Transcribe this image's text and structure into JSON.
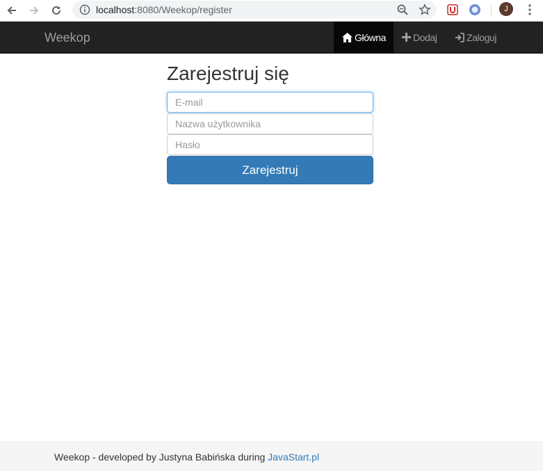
{
  "browser": {
    "url_host": "localhost",
    "url_rest": ":8080/Weekop/register",
    "avatar_letter": "J"
  },
  "navbar": {
    "brand": "Weekop",
    "items": [
      {
        "label": "Główna",
        "icon": "home-icon",
        "active": true
      },
      {
        "label": "Dodaj",
        "icon": "plus-icon",
        "active": false
      },
      {
        "label": "Zaloguj",
        "icon": "login-icon",
        "active": false
      }
    ]
  },
  "form": {
    "title": "Zarejestruj się",
    "email_placeholder": "E-mail",
    "username_placeholder": "Nazwa użytkownika",
    "password_placeholder": "Hasło",
    "submit_label": "Zarejestruj"
  },
  "footer": {
    "text": "Weekop - developed by Justyna Babińska during",
    "link": "JavaStart.pl"
  },
  "colors": {
    "navbar_bg": "#222222",
    "primary": "#337ab7",
    "link": "#337ab7"
  }
}
